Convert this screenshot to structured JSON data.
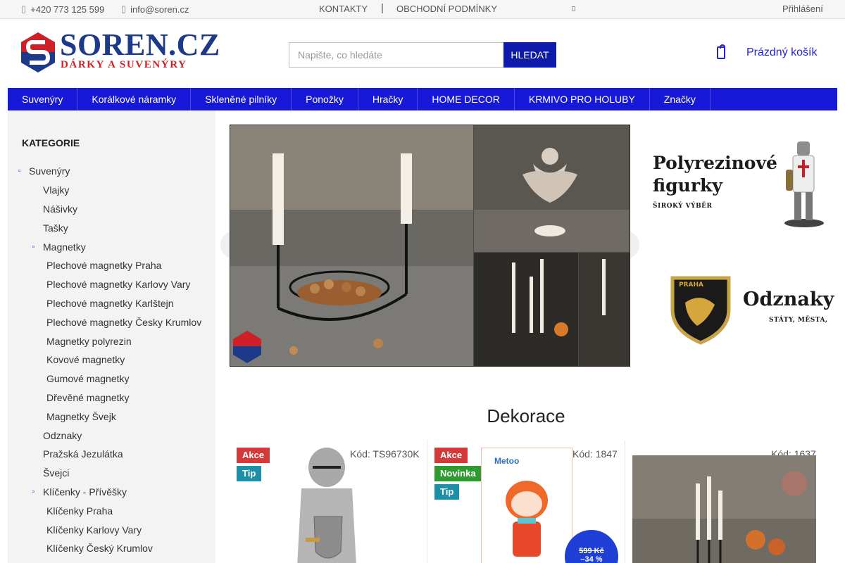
{
  "topbar": {
    "phone": "+420 773 125 599",
    "email": "info@soren.cz",
    "contacts": "KONTAKTY",
    "terms": "OBCHODNÍ PODMÍNKY",
    "login": "Přihlášení"
  },
  "logo": {
    "name": "SOREN.CZ",
    "tagline": "DÁRKY A SUVENÝRY"
  },
  "search": {
    "placeholder": "Napište, co hledáte",
    "button": "HLEDAT"
  },
  "cart": {
    "label": "Prázdný košík"
  },
  "nav": [
    "Suvenýry",
    "Korálkové náramky",
    "Skleněné pilníky",
    "Ponožky",
    "Hračky",
    "HOME DECOR",
    "KRMIVO PRO HOLUBY",
    "Značky"
  ],
  "sidebar": {
    "title": "KATEGORIE",
    "items": [
      {
        "label": "Suvenýry",
        "level": 0,
        "expanded": true
      },
      {
        "label": "Vlajky",
        "level": 1
      },
      {
        "label": "Nášivky",
        "level": 1
      },
      {
        "label": "Tašky",
        "level": 1
      },
      {
        "label": "Magnetky",
        "level": 1,
        "expanded": true
      },
      {
        "label": "Plechové magnetky Praha",
        "level": 2
      },
      {
        "label": "Plechové magnetky Karlovy Vary",
        "level": 2
      },
      {
        "label": "Plechové magnetky Karlštejn",
        "level": 2
      },
      {
        "label": "Plechové magnetky Česky Krumlov",
        "level": 2
      },
      {
        "label": "Magnetky polyrezin",
        "level": 2
      },
      {
        "label": "Kovové magnetky",
        "level": 2
      },
      {
        "label": "Gumové magnetky",
        "level": 2
      },
      {
        "label": "Dřevěné magnetky",
        "level": 2
      },
      {
        "label": "Magnetky Švejk",
        "level": 2
      },
      {
        "label": "Odznaky",
        "level": 1
      },
      {
        "label": "Pražská Jezulátka",
        "level": 1
      },
      {
        "label": "Švejci",
        "level": 1
      },
      {
        "label": "Klíčenky - Přívěšky",
        "level": 1,
        "expanded": true
      },
      {
        "label": "Klíčenky Praha",
        "level": 2
      },
      {
        "label": "Klíčenky Karlovy Vary",
        "level": 2
      },
      {
        "label": "Klíčenky Český Krumlov",
        "level": 2
      }
    ]
  },
  "promos": [
    {
      "title_line1": "Polyrezinové",
      "title_line2": "figurky",
      "subtitle": "ŠIROKÝ VÝBĚR"
    },
    {
      "title": "Odznaky",
      "subtitle": "STÁTY, MĚSTA,",
      "badge_text": "PRAHA"
    }
  ],
  "section": {
    "title": "Dekorace"
  },
  "products": [
    {
      "code": "Kód: TS96730K",
      "badges": [
        "Akce",
        "Tip"
      ]
    },
    {
      "code": "Kód: 1847",
      "badges": [
        "Akce",
        "Novinka",
        "Tip"
      ],
      "brand": "Metoo",
      "old_price": "599 Kč",
      "discount": "–34 %"
    },
    {
      "code": "Kód: 1637",
      "badges": []
    }
  ],
  "colors": {
    "brand_blue": "#1818d8",
    "dark_blue": "#0e1aa9",
    "logo_red": "#d11f27"
  }
}
